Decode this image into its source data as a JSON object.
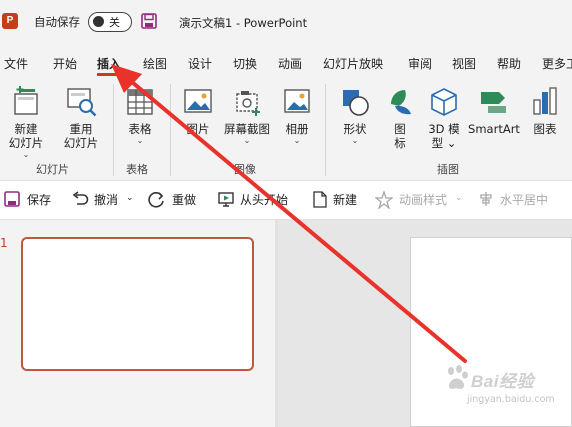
{
  "app": {
    "logo_letter": "P",
    "autosave_label": "自动保存",
    "autosave_state": "关",
    "document_title": "演示文稿1  -  PowerPoint"
  },
  "tabs": [
    {
      "label": "文件"
    },
    {
      "label": "开始"
    },
    {
      "label": "插入",
      "active": true
    },
    {
      "label": "绘图"
    },
    {
      "label": "设计"
    },
    {
      "label": "切换"
    },
    {
      "label": "动画"
    },
    {
      "label": "幻灯片放映"
    },
    {
      "label": "审阅"
    },
    {
      "label": "视图"
    },
    {
      "label": "帮助"
    },
    {
      "label": "更多工"
    }
  ],
  "ribbon": {
    "new_slide": {
      "line1": "新建",
      "line2": "幻灯片",
      "chevron": "⌄",
      "icon": "new-slide-icon"
    },
    "reuse_slides": {
      "line1": "重用",
      "line2": "幻灯片",
      "icon": "reuse-slides-icon"
    },
    "table": {
      "label": "表格",
      "chevron": "⌄",
      "icon": "table-icon"
    },
    "picture": {
      "label": "图片",
      "icon": "picture-icon"
    },
    "screenshot": {
      "label": "屏幕截图",
      "chevron": "⌄",
      "icon": "screenshot-icon"
    },
    "album": {
      "label": "相册",
      "chevron": "⌄",
      "icon": "photo-album-icon"
    },
    "shapes": {
      "label": "形状",
      "chevron": "⌄",
      "icon": "shapes-icon"
    },
    "icons": {
      "line1": "图",
      "line2": "标",
      "icon": "icons-icon"
    },
    "model3d": {
      "line1": "3D 模",
      "line2": "型 ⌄",
      "icon": "3d-model-icon"
    },
    "smartart": {
      "label": "SmartArt",
      "icon": "smartart-icon"
    },
    "chart": {
      "label": "图表",
      "icon": "chart-icon"
    },
    "groups": {
      "slides": "幻灯片",
      "tables": "表格",
      "images": "图像",
      "illustrations": "插图"
    }
  },
  "toolbar": {
    "save": "保存",
    "undo": "撤消",
    "undo_chevron": "⌄",
    "redo": "重做",
    "from_start": "从头开始",
    "new": "新建",
    "animation_styles": "动画样式",
    "animation_chevron": "⌄",
    "align_center": "水平居中"
  },
  "slides": {
    "current_number": "1"
  },
  "watermark": {
    "brand": "Bai经验",
    "url": "jingyan.baidu.com"
  },
  "colors": {
    "accent": "#c43e1c",
    "arrow": "#e8322a",
    "ribbon_bg": "#f3f3f3"
  }
}
